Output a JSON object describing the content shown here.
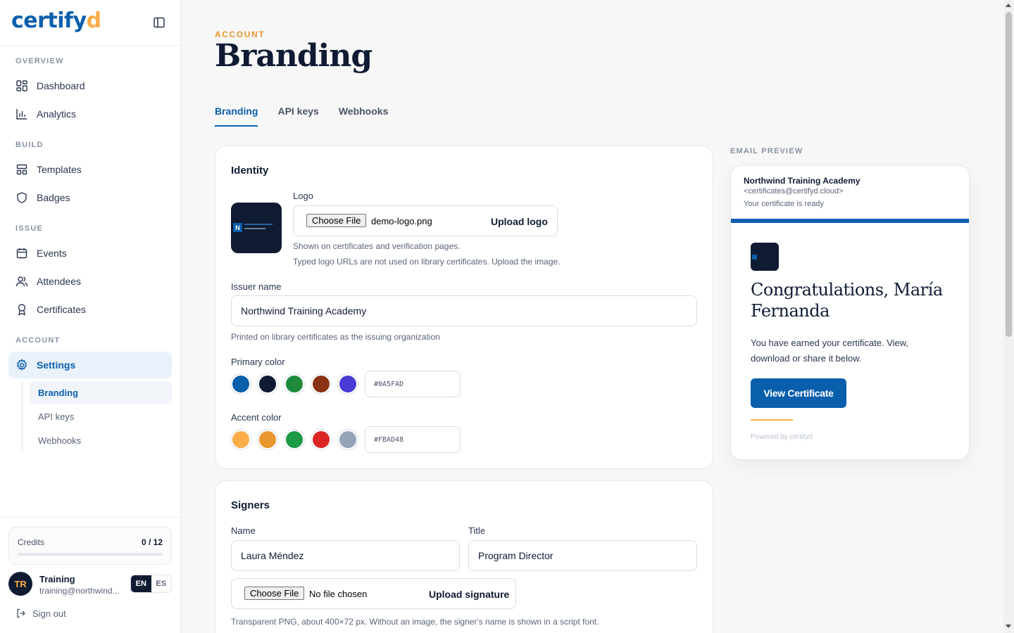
{
  "brand": {
    "name_main": "certify",
    "name_accent": "d"
  },
  "sidebar": {
    "sections": [
      "OVERVIEW",
      "BUILD",
      "ISSUE",
      "ACCOUNT"
    ],
    "items": [
      {
        "label": "Dashboard",
        "icon": "dashboard-icon"
      },
      {
        "label": "Analytics",
        "icon": "bar-chart-icon"
      },
      {
        "label": "Templates",
        "icon": "layout-icon"
      },
      {
        "label": "Badges",
        "icon": "shield-icon"
      },
      {
        "label": "Events",
        "icon": "calendar-icon"
      },
      {
        "label": "Attendees",
        "icon": "users-icon"
      },
      {
        "label": "Certificates",
        "icon": "award-icon"
      },
      {
        "label": "Settings",
        "icon": "gear-icon"
      }
    ],
    "sub_items": [
      "Branding",
      "API keys",
      "Webhooks"
    ],
    "credits": {
      "label": "Credits",
      "value": "0 / 12",
      "used_fraction": 0
    },
    "user": {
      "initials": "TR",
      "name": "Training",
      "email": "training@northwind..."
    },
    "languages": [
      "EN",
      "ES"
    ],
    "sign_out": "Sign out"
  },
  "page": {
    "eyebrow": "ACCOUNT",
    "title": "Branding",
    "tabs": [
      "Branding",
      "API keys",
      "Webhooks"
    ]
  },
  "identity": {
    "title": "Identity",
    "logo_label": "Logo",
    "logo_thumb_mark": "N",
    "choose_file": "Choose File",
    "file_name": "demo-logo.png",
    "upload_logo": "Upload logo",
    "logo_hint_1": "Shown on certificates and verification pages.",
    "logo_hint_2": "Typed logo URLs are not used on library certificates. Upload the image.",
    "issuer_label": "Issuer name",
    "issuer_value": "Northwind Training Academy",
    "issuer_hint": "Printed on library certificates as the issuing organization",
    "primary_label": "Primary color",
    "primary_swatches": [
      "#0a5fad",
      "#0f1b33",
      "#1e8a3c",
      "#8a3312",
      "#4b3ad6"
    ],
    "primary_hex": "#0A5FAD",
    "accent_label": "Accent color",
    "accent_swatches": [
      "#fbad48",
      "#e8962e",
      "#1d9a46",
      "#dc2626",
      "#94a3b8"
    ],
    "accent_hex": "#FBAD48"
  },
  "signers": {
    "title": "Signers",
    "name_label": "Name",
    "title_label": "Title",
    "name_value": "Laura Méndez",
    "title_value": "Program Director",
    "choose_file": "Choose File",
    "file_name": "No file chosen",
    "upload_signature": "Upload signature",
    "hint": "Transparent PNG, about 400×72 px. Without an image, the signer's name is shown in a script font."
  },
  "preview": {
    "label": "EMAIL PREVIEW",
    "from": "Northwind Training Academy",
    "address": "<certificates@certifyd.cloud>",
    "subject": "Your certificate is ready",
    "heading": "Congratulations, María Fernanda",
    "body": "You have earned your certificate. View, download or share it below.",
    "button": "View Certificate",
    "powered": "Powered by certifyd"
  }
}
